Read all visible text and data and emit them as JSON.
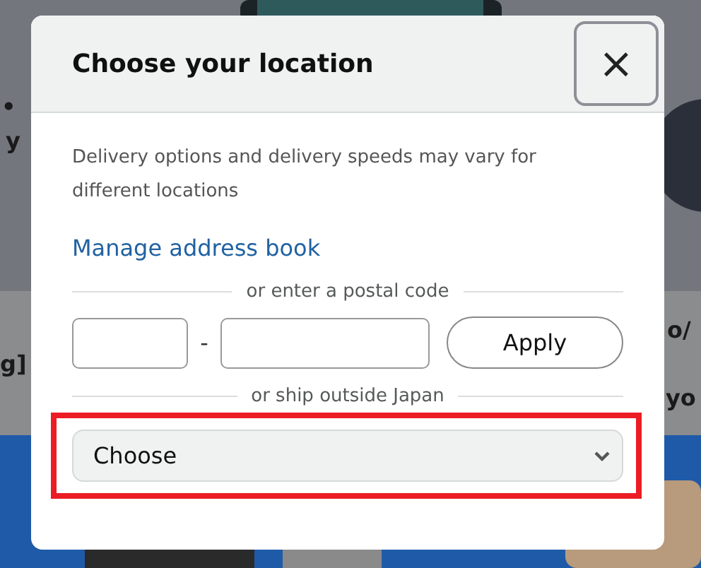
{
  "background": {
    "fragments": [
      {
        "text": "•"
      },
      {
        "text": "y"
      },
      {
        "text": "o/"
      },
      {
        "text": "g]"
      },
      {
        "text": "yo"
      }
    ]
  },
  "dialog": {
    "title": "Choose your location",
    "close": "×",
    "description": "Delivery options and delivery speeds may vary for different locations",
    "link": "Manage address book",
    "postal_divider": "or enter a postal code",
    "postal_separator": "-",
    "apply": "Apply",
    "outside_divider": "or ship outside Japan",
    "country_select": {
      "value": "Choose",
      "highlighted": true
    }
  }
}
